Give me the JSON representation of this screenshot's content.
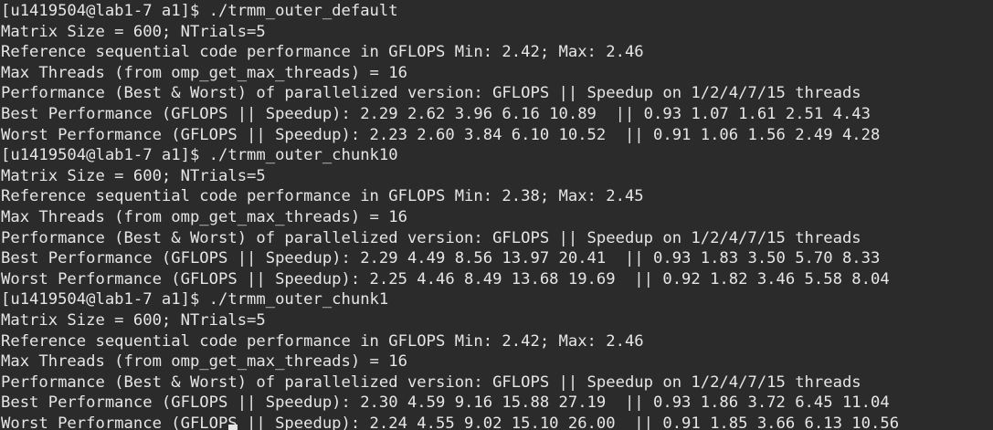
{
  "terminal": {
    "lines": [
      "[u1419504@lab1-7 a1]$ ./trmm_outer_default",
      "Matrix Size = 600; NTrials=5",
      "Reference sequential code performance in GFLOPS Min: 2.42; Max: 2.46",
      "Max Threads (from omp_get_max_threads) = 16",
      "Performance (Best & Worst) of parallelized version: GFLOPS || Speedup on 1/2/4/7/15 threads",
      "Best Performance (GFLOPS || Speedup): 2.29 2.62 3.96 6.16 10.89  || 0.93 1.07 1.61 2.51 4.43",
      "Worst Performance (GFLOPS || Speedup): 2.23 2.60 3.84 6.10 10.52  || 0.91 1.06 1.56 2.49 4.28",
      "[u1419504@lab1-7 a1]$ ./trmm_outer_chunk10",
      "Matrix Size = 600; NTrials=5",
      "Reference sequential code performance in GFLOPS Min: 2.38; Max: 2.45",
      "Max Threads (from omp_get_max_threads) = 16",
      "Performance (Best & Worst) of parallelized version: GFLOPS || Speedup on 1/2/4/7/15 threads",
      "Best Performance (GFLOPS || Speedup): 2.29 4.49 8.56 13.97 20.41  || 0.93 1.83 3.50 5.70 8.33",
      "Worst Performance (GFLOPS || Speedup): 2.25 4.46 8.49 13.68 19.69  || 0.92 1.82 3.46 5.58 8.04",
      "[u1419504@lab1-7 a1]$ ./trmm_outer_chunk1",
      "Matrix Size = 600; NTrials=5",
      "Reference sequential code performance in GFLOPS Min: 2.42; Max: 2.46",
      "Max Threads (from omp_get_max_threads) = 16",
      "Performance (Best & Worst) of parallelized version: GFLOPS || Speedup on 1/2/4/7/15 threads",
      "Best Performance (GFLOPS || Speedup): 2.30 4.59 9.16 15.88 27.19  || 0.93 1.86 3.72 6.45 11.04",
      "Worst Performance (GFLOPS || Speedup): 2.24 4.55 9.02 15.10 26.00  || 0.91 1.85 3.66 6.13 10.56"
    ]
  },
  "colors": {
    "background": "#2b2b2b",
    "foreground": "#e6e6e6"
  }
}
